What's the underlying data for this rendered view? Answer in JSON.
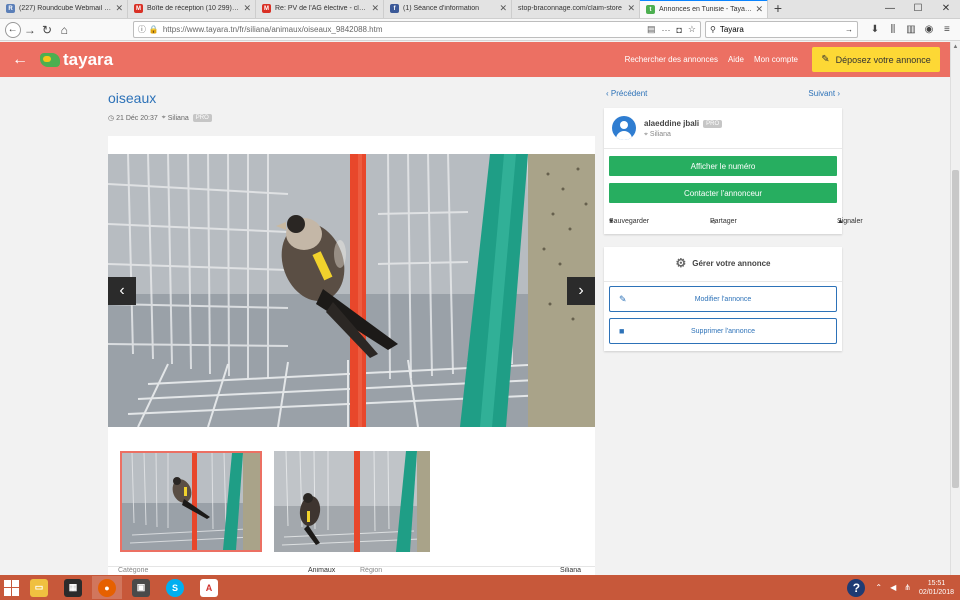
{
  "browser": {
    "tabs": [
      {
        "label": "(227) Roundcube Webmail 1.3.3",
        "color": "#5b7fb8",
        "glyph": "R"
      },
      {
        "label": "Boîte de réception (10 299) - a...",
        "color": "#d93025",
        "glyph": "M"
      },
      {
        "label": "Re: PV de l'AG élective - claudi...",
        "color": "#d93025",
        "glyph": "M"
      },
      {
        "label": "(1) Séance d'information",
        "color": "#3b5998",
        "glyph": "f"
      },
      {
        "label": "stop-braconnage.com/claim-store",
        "color": "#e8e8e8",
        "glyph": ""
      },
      {
        "label": "Annonces en Tunisie - Tayara.tn",
        "color": "#4caf50",
        "glyph": "t"
      }
    ],
    "new_tab": "+",
    "url": "https://www.tayara.tn/fr/siliana/animaux/oiseaux_9842088.htm",
    "search_value": "Tayara"
  },
  "site": {
    "logo": "tayara",
    "nav": {
      "search": "Rechercher des annonces",
      "help": "Aide",
      "account": "Mon compte"
    },
    "post_button": "Déposez votre annonce"
  },
  "listing": {
    "title": "oiseaux",
    "date": "21 Déc 20:37",
    "location": "Siliana",
    "badge": "PRO",
    "details": {
      "category_label": "Catégorie",
      "category_value": "Animaux",
      "region_label": "Région",
      "region_value": "Siliana"
    }
  },
  "pager": {
    "prev": "Précédent",
    "next": "Suivant"
  },
  "seller": {
    "name": "alaeddine jbali",
    "badge": "PRO",
    "city": "Siliana",
    "show_number": "Afficher le numéro",
    "contact": "Contacter l'annonceur",
    "save": "Sauvegarder",
    "share": "Partager",
    "report": "Signaler"
  },
  "manage": {
    "title": "Gérer votre annonce",
    "edit": "Modifier l'annonce",
    "delete": "Supprimer l'annonce"
  },
  "taskbar": {
    "time": "15:51",
    "date": "02/01/2018"
  }
}
